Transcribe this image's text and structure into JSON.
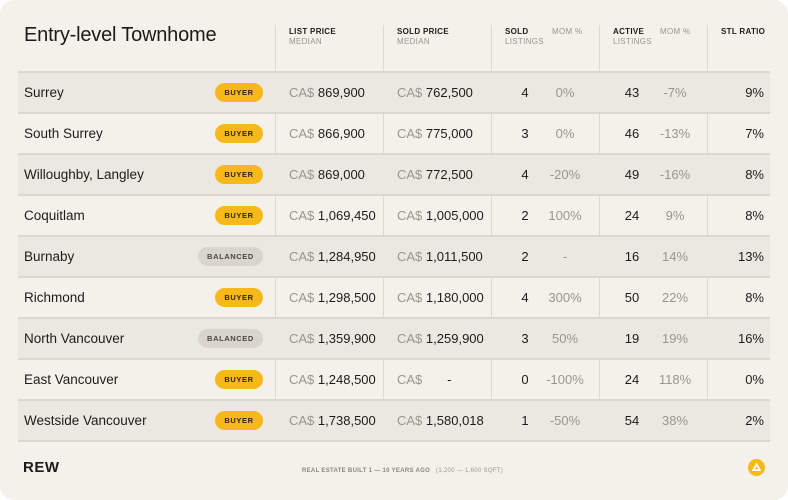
{
  "title": "Entry-level Townhome",
  "headers": {
    "list_price": "LIST PRICE",
    "list_price_sub": "MEDIAN",
    "sold_price": "SOLD PRICE",
    "sold_price_sub": "MEDIAN",
    "sold": "SOLD",
    "sold_sub": "LISTINGS",
    "mom1": "MOM %",
    "active": "ACTIVE",
    "active_sub": "LISTINGS",
    "mom2": "MOM %",
    "stl": "STL RATIO"
  },
  "currency": "CA$",
  "rows": [
    {
      "name": "Surrey",
      "badge": "BUYER",
      "badge_type": "buyer",
      "list": "869,900",
      "sold_price": "762,500",
      "sold": "4",
      "mom1": "0%",
      "active": "43",
      "mom2": "-7%",
      "stl": "9%"
    },
    {
      "name": "South Surrey",
      "badge": "BUYER",
      "badge_type": "buyer",
      "list": "866,900",
      "sold_price": "775,000",
      "sold": "3",
      "mom1": "0%",
      "active": "46",
      "mom2": "-13%",
      "stl": "7%"
    },
    {
      "name": "Willoughby, Langley",
      "badge": "BUYER",
      "badge_type": "buyer",
      "list": "869,000",
      "sold_price": "772,500",
      "sold": "4",
      "mom1": "-20%",
      "active": "49",
      "mom2": "-16%",
      "stl": "8%"
    },
    {
      "name": "Coquitlam",
      "badge": "BUYER",
      "badge_type": "buyer",
      "list": "1,069,450",
      "sold_price": "1,005,000",
      "sold": "2",
      "mom1": "100%",
      "active": "24",
      "mom2": "9%",
      "stl": "8%"
    },
    {
      "name": "Burnaby",
      "badge": "BALANCED",
      "badge_type": "balanced",
      "list": "1,284,950",
      "sold_price": "1,011,500",
      "sold": "2",
      "mom1": "-",
      "active": "16",
      "mom2": "14%",
      "stl": "13%"
    },
    {
      "name": "Richmond",
      "badge": "BUYER",
      "badge_type": "buyer",
      "list": "1,298,500",
      "sold_price": "1,180,000",
      "sold": "4",
      "mom1": "300%",
      "active": "50",
      "mom2": "22%",
      "stl": "8%"
    },
    {
      "name": "North Vancouver",
      "badge": "BALANCED",
      "badge_type": "balanced",
      "list": "1,359,900",
      "sold_price": "1,259,900",
      "sold": "3",
      "mom1": "50%",
      "active": "19",
      "mom2": "19%",
      "stl": "16%"
    },
    {
      "name": "East Vancouver",
      "badge": "BUYER",
      "badge_type": "buyer",
      "list": "1,248,500",
      "sold_price": "-",
      "sold": "0",
      "mom1": "-100%",
      "active": "24",
      "mom2": "118%",
      "stl": "0%"
    },
    {
      "name": "Westside Vancouver",
      "badge": "BUYER",
      "badge_type": "buyer",
      "list": "1,738,500",
      "sold_price": "1,580,018",
      "sold": "1",
      "mom1": "-50%",
      "active": "54",
      "mom2": "38%",
      "stl": "2%"
    }
  ],
  "footer": {
    "logo": "REW",
    "note_bold": "REAL ESTATE BUILT 1 — 10 YEARS AGO",
    "note_light": "(1,200 — 1,600 SQFT)",
    "icon": "warning-triangle-icon"
  }
}
